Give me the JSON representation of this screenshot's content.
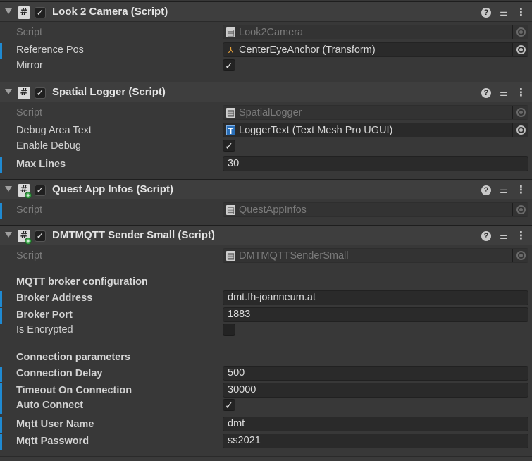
{
  "components": [
    {
      "title": "Look 2 Camera (Script)",
      "script_label": "Script",
      "script_value": "Look2Camera",
      "fields": [
        {
          "label": "Reference Pos",
          "value": "CenterEyeAnchor (Transform)",
          "icon": "transform-icon"
        },
        {
          "label": "Mirror",
          "checked": true
        }
      ]
    },
    {
      "title": "Spatial Logger (Script)",
      "script_label": "Script",
      "script_value": "SpatialLogger",
      "fields": [
        {
          "label": "Debug Area Text",
          "value": "LoggerText (Text Mesh Pro UGUI)",
          "icon": "text-mesh-pro-icon"
        },
        {
          "label": "Enable Debug",
          "checked": true
        },
        {
          "label": "Max Lines",
          "value": "30"
        }
      ]
    },
    {
      "title": "Quest App Infos (Script)",
      "script_label": "Script",
      "script_value": "QuestAppInfos"
    },
    {
      "title": "DMTMQTT Sender Small (Script)",
      "script_label": "Script",
      "script_value": "DMTMQTTSenderSmall",
      "sections": [
        {
          "header": "MQTT broker configuration",
          "fields": [
            {
              "label": "Broker Address",
              "value": "dmt.fh-joanneum.at"
            },
            {
              "label": "Broker Port",
              "value": "1883"
            },
            {
              "label": "Is Encrypted",
              "checked": false
            }
          ]
        },
        {
          "header": "Connection parameters",
          "fields": [
            {
              "label": "Connection Delay",
              "value": "500"
            },
            {
              "label": "Timeout On Connection",
              "value": "30000"
            },
            {
              "label": "Auto Connect",
              "checked": true
            },
            {
              "label": "Mqtt User Name",
              "value": "dmt"
            },
            {
              "label": "Mqtt Password",
              "value": "ss2021"
            }
          ]
        }
      ]
    }
  ],
  "icons": {
    "help": "?",
    "preset": "⚌",
    "menu": "⋮",
    "check": "✓"
  },
  "colors": {
    "accent_bar": "#1f8ad2",
    "panel_bg": "#383838",
    "header_bg": "#3e3e3e"
  }
}
